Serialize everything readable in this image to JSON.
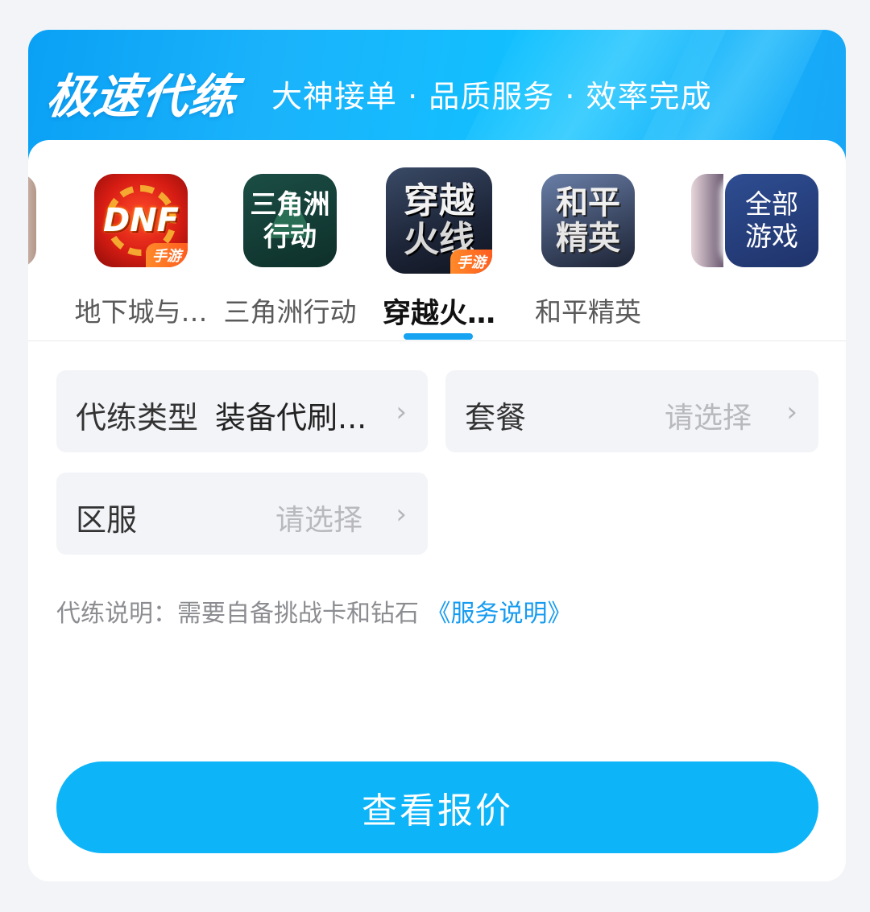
{
  "banner": {
    "title": "极速代练",
    "subtitle": "大神接单 · 品质服务 · 效率完成"
  },
  "games": [
    {
      "label": "地下城与…",
      "icon_text": "DNF",
      "badge": "手游",
      "icon": "dnf-icon"
    },
    {
      "label": "三角洲行动",
      "icon_text_1": "三角洲",
      "icon_text_2": "行动",
      "icon": "delta-force-icon"
    },
    {
      "label": "穿越火…",
      "icon_text_1": "穿越",
      "icon_text_2": "火线",
      "badge": "手游",
      "icon": "crossfire-icon",
      "active": true
    },
    {
      "label": "和平精英",
      "icon_text_1": "和平",
      "icon_text_2": "精英",
      "icon": "peace-elite-icon"
    }
  ],
  "all_games": {
    "line1": "全部",
    "line2": "游戏"
  },
  "form": {
    "type_label": "代练类型",
    "type_value": "装备代刷...",
    "package_label": "套餐",
    "package_placeholder": "请选择",
    "server_label": "区服",
    "server_placeholder": "请选择",
    "chevron": "›"
  },
  "note": {
    "text": "代练说明：需要自备挑战卡和钻石",
    "link": "《服务说明》"
  },
  "cta": {
    "label": "查看报价"
  },
  "colors": {
    "accent": "#0db5f8",
    "link": "#159bf0",
    "banner": "#12b0fb"
  }
}
